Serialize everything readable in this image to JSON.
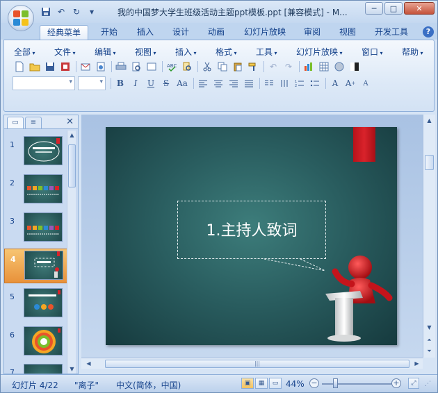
{
  "window": {
    "title": "我的中国梦大学生班级活动主题ppt模板.ppt [兼容模式] - M...",
    "minimize": "─",
    "maximize": "□",
    "close": "✕"
  },
  "quick_access": {
    "save_icon": "save-icon",
    "undo": "↶",
    "redo": "↻",
    "customize": "▾"
  },
  "tabs": [
    "经典菜单",
    "开始",
    "插入",
    "设计",
    "动画",
    "幻灯片放映",
    "审阅",
    "视图",
    "开发工具"
  ],
  "help": "?",
  "menu": [
    "全部",
    "文件",
    "编辑",
    "视图",
    "插入",
    "格式",
    "工具",
    "幻灯片放映",
    "窗口",
    "帮助"
  ],
  "format_buttons": {
    "bold": "B",
    "italic": "I",
    "underline": "U",
    "strike": "S",
    "case": "Aa"
  },
  "slides": {
    "numbers": [
      "1",
      "2",
      "3",
      "4",
      "5",
      "6",
      "7"
    ],
    "selected": "4"
  },
  "slide": {
    "title": "1.主持人致词"
  },
  "status": {
    "slide_info": "幻灯片 4/22",
    "theme": "\"离子\"",
    "language": "中文(简体，中国)",
    "zoom": "44%",
    "zoom_level_percent": 44
  },
  "colors": {
    "accent": "#15428b",
    "slide_bg": "#2a5e60",
    "bookmark": "#d9232b",
    "selected_thumb": "#f0a850"
  }
}
